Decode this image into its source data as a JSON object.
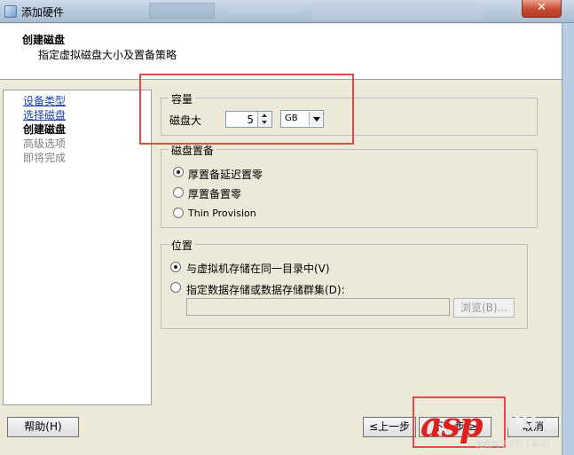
{
  "window": {
    "title": "添加硬件",
    "close_glyph": "✕"
  },
  "header": {
    "title": "创建磁盘",
    "subtitle": "指定虚拟磁盘大小及置备策略"
  },
  "nav": {
    "items": [
      {
        "label": "设备类型",
        "state": "link"
      },
      {
        "label": "选择磁盘",
        "state": "link"
      },
      {
        "label": "创建磁盘",
        "state": "current"
      },
      {
        "label": "高级选项",
        "state": "disabled"
      },
      {
        "label": "即将完成",
        "state": "disabled"
      }
    ]
  },
  "capacity": {
    "legend": "容量",
    "disk_size_label": "磁盘大",
    "disk_size_value": "5",
    "unit_value": "GB"
  },
  "provisioning": {
    "legend": "磁盘置备",
    "options": [
      {
        "label": "厚置备延迟置零",
        "checked": true
      },
      {
        "label": "厚置备置零",
        "checked": false
      },
      {
        "label": "Thin Provision",
        "checked": false
      }
    ]
  },
  "location": {
    "legend": "位置",
    "option_same": "与虚拟机存储在同一目录中(V)",
    "option_specify": "指定数据存储或数据存储群集(D):",
    "path_value": "",
    "browse_label": "浏览(B)..."
  },
  "footer": {
    "help_label": "帮助(H)",
    "back_label": "≤上一步",
    "next_label": "下一步 ≥",
    "cancel_label": "取消"
  },
  "watermark": {
    "brand_main": "asp",
    "brand_tail": "ku",
    "tagline": "免费网站源码下载站!"
  },
  "colors": {
    "annotation": "#e24848",
    "link": "#1c3fa8",
    "watermark": "#e01f1f"
  }
}
